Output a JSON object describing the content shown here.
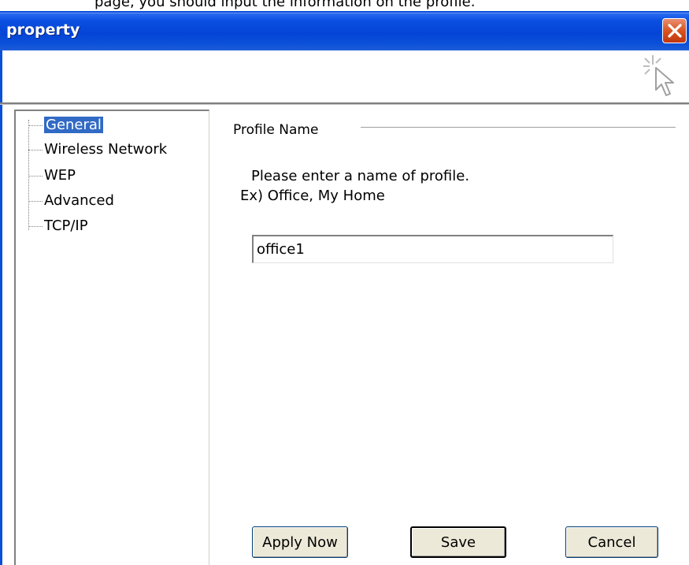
{
  "window": {
    "title": "property",
    "top_fragment_text": "page, you should input the information on the profile."
  },
  "tree": {
    "items": [
      {
        "label": "General",
        "selected": true
      },
      {
        "label": "Wireless Network",
        "selected": false
      },
      {
        "label": "WEP",
        "selected": false
      },
      {
        "label": "Advanced",
        "selected": false
      },
      {
        "label": "TCP/IP",
        "selected": false
      }
    ]
  },
  "profile": {
    "group_label": "Profile Name",
    "instruction_line1": "Please enter a name of profile.",
    "instruction_line2": "Ex) Office, My Home",
    "name_value": "office1"
  },
  "buttons": {
    "apply_now": "Apply Now",
    "save": "Save",
    "cancel": "Cancel"
  },
  "icons": {
    "close": "close-icon",
    "cursor": "click-cursor-icon"
  },
  "colors": {
    "titlebar": "#0444d6",
    "close_button": "#d9541f",
    "selection": "#316ac5"
  }
}
